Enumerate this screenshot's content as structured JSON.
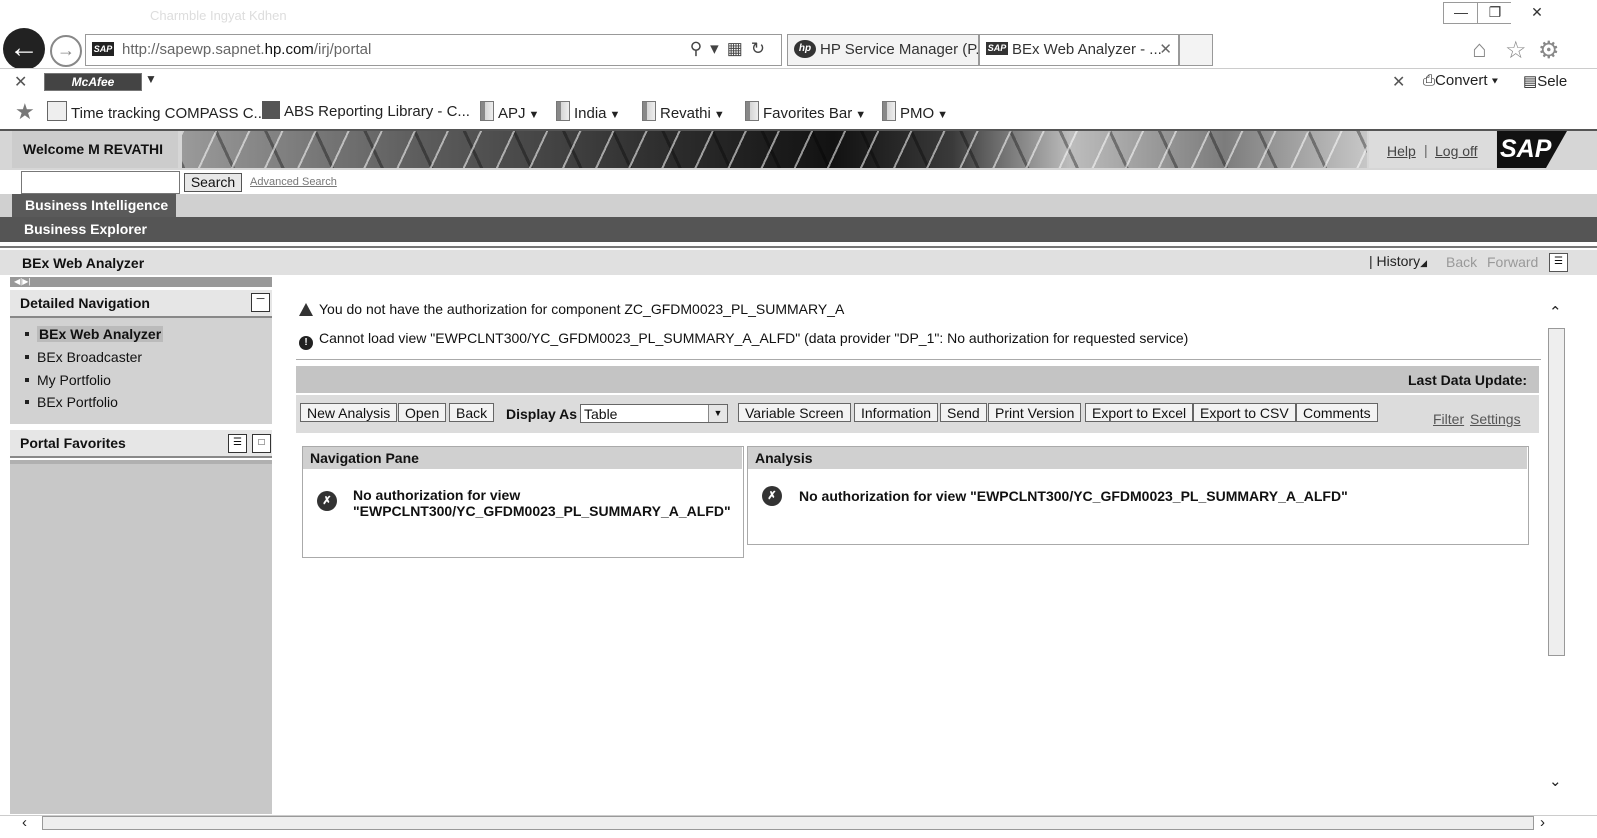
{
  "browser": {
    "window_title": "Charmble  Ingyat Kdhen",
    "address_url_prefix": "http://sapewp.sapnet.",
    "address_url_domain": "hp.com",
    "address_url_path": "/irj/portal",
    "tabs": [
      {
        "label": "HP Service Manager (P...",
        "icon": "hp-icon"
      },
      {
        "label": "BEx Web Analyzer - ...",
        "icon": "sap-icon"
      }
    ],
    "toolbar_right_icons": [
      "home-icon",
      "star-icon",
      "gear-icon"
    ]
  },
  "mcafee": {
    "logo": "McAfee",
    "convert_label": "Convert",
    "select_label": "Sele"
  },
  "favorites": [
    {
      "label": "Time tracking COMPASS C...",
      "type": "page"
    },
    {
      "label": "ABS Reporting Library - C...",
      "type": "library"
    },
    {
      "label": "APJ",
      "type": "folder"
    },
    {
      "label": "India",
      "type": "folder"
    },
    {
      "label": "Revathi",
      "type": "folder"
    },
    {
      "label": "Favorites Bar",
      "type": "folder"
    },
    {
      "label": "PMO",
      "type": "folder"
    }
  ],
  "portal": {
    "welcome": "Welcome M REVATHI",
    "help": "Help",
    "logoff": "Log off",
    "logo": "SAP",
    "search_button": "Search",
    "advanced_search": "Advanced Search",
    "search_value": "",
    "level1_tab": "Business Intelligence",
    "level2_tab": "Business Explorer",
    "page_title": "BEx Web Analyzer",
    "history": "History",
    "back": "Back",
    "forward": "Forward"
  },
  "left_nav": {
    "detailed_title": "Detailed Navigation",
    "items": [
      "BEx Web Analyzer",
      "BEx Broadcaster",
      "My Portfolio",
      "BEx Portfolio"
    ],
    "active_item": "BEx Web Analyzer",
    "favorites_title": "Portal Favorites"
  },
  "messages": {
    "warning": "You do not have the authorization for component ZC_GFDM0023_PL_SUMMARY_A",
    "error": "Cannot load view \"EWPCLNT300/YC_GFDM0023_PL_SUMMARY_A_ALFD\" (data provider \"DP_1\": No authorization for requested service)"
  },
  "analyzer": {
    "last_data_update": "Last Data Update:",
    "buttons": {
      "new_analysis": "New Analysis",
      "open": "Open",
      "back": "Back",
      "variable_screen": "Variable Screen",
      "information": "Information",
      "send": "Send",
      "print_version": "Print Version",
      "export_excel": "Export to Excel",
      "export_csv": "Export to CSV",
      "comments": "Comments"
    },
    "display_as_label": "Display As",
    "display_as_value": "Table",
    "filter_link": "Filter",
    "settings_link": "Settings",
    "nav_pane_title": "Navigation Pane",
    "nav_pane_line1": "No authorization for view",
    "nav_pane_line2": "\"EWPCLNT300/YC_GFDM0023_PL_SUMMARY_A_ALFD\"",
    "analysis_title": "Analysis",
    "analysis_msg": "No authorization for view \"EWPCLNT300/YC_GFDM0023_PL_SUMMARY_A_ALFD\""
  }
}
